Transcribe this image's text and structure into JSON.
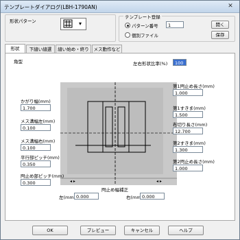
{
  "window": {
    "title": "テンプレートダイアログ(LBH-1790AN)",
    "close_glyph": "✕"
  },
  "shape_pattern": {
    "label": "形状パターン",
    "dropdown_glyph": "▾"
  },
  "template_register": {
    "title": "テンプレート登録",
    "pattern_number_label": "パターン番号",
    "pattern_number_value": "1",
    "file_label": "個別ファイル",
    "open_button": "開く",
    "save_button": "保存"
  },
  "tabs": [
    "形状",
    "下縫い縫選",
    "縫い始め・終り",
    "メス動作など"
  ],
  "panel": {
    "section_label": "角型",
    "lr_ratio_label": "左右形状比率(%)",
    "lr_ratio_value": "100",
    "left_fields": [
      {
        "label": "かがり幅(mm)",
        "value": "1.700"
      },
      {
        "label": "メス溝幅左(mm)",
        "value": "0.100"
      },
      {
        "label": "メス溝幅右(mm)",
        "value": "0.100"
      },
      {
        "label": "平行部ピッチ(mm)",
        "value": "0.350"
      },
      {
        "label": "閂止め部ピッチ(mm)",
        "value": "0.300"
      }
    ],
    "right_fields": [
      {
        "label": "第1閂止め長さ(mm)",
        "value": "1.000"
      },
      {
        "label": "第1すきま(mm)",
        "value": "1.500"
      },
      {
        "label": "布切り長さ(mm)",
        "value": "12.700"
      },
      {
        "label": "第2すきま(mm)",
        "value": "1.300"
      },
      {
        "label": "第2閂止め長さ(mm)",
        "value": "1.000"
      }
    ],
    "bar_width_title": "閂止め幅補正",
    "left_mm_label": "左(mm)",
    "left_mm_value": "0.000",
    "right_mm_label": "右(mm)",
    "right_mm_value": "0.000"
  },
  "footer": {
    "ok": "OK",
    "preview": "プレビュー",
    "cancel": "キャンセル",
    "help": "ヘルプ"
  }
}
